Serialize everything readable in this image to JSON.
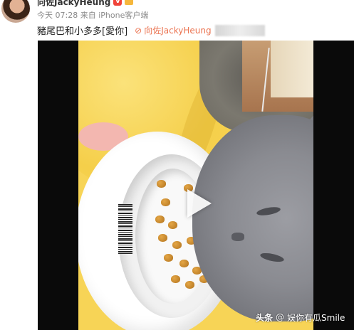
{
  "post": {
    "author_name": "向佐JackyHeung",
    "badge_icon": "vip-badge-icon",
    "crown_icon": "crown-icon",
    "time": "今天 07:28",
    "source_prefix": "来自",
    "source_client": "iPhone客户端",
    "text": "豬尾巴和小多多[愛你]",
    "mention_label": "向佐JackyHeung",
    "mention_icon": "link-icon"
  },
  "video": {
    "play_icon": "play-icon",
    "watermark_brand": "头条",
    "watermark_at": "@",
    "watermark_account": "娱你有瓜Smile"
  },
  "colors": {
    "mention": "#eb7350",
    "meta": "#8a8a8a",
    "vip_badge": "#f0443a"
  }
}
